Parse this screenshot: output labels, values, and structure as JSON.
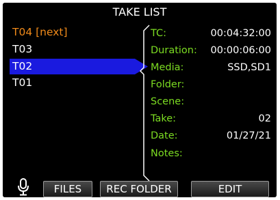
{
  "title": "TAKE LIST",
  "takes": [
    {
      "label": "T04 [next]",
      "state": "next"
    },
    {
      "label": "T03",
      "state": "normal"
    },
    {
      "label": "T02",
      "state": "selected"
    },
    {
      "label": "T01",
      "state": "normal"
    }
  ],
  "details": [
    {
      "label": "TC:",
      "value": "00:04:32:00"
    },
    {
      "label": "Duration:",
      "value": "00:00:06:00"
    },
    {
      "label": "Media:",
      "value": "SSD,SD1"
    },
    {
      "label": "Folder:",
      "value": ""
    },
    {
      "label": "Scene:",
      "value": ""
    },
    {
      "label": "Take:",
      "value": "02"
    },
    {
      "label": "Date:",
      "value": "01/27/21"
    },
    {
      "label": "Notes:",
      "value": ""
    }
  ],
  "toolbar": {
    "mic_icon": "microphone-icon",
    "files_label": "FILES",
    "rec_folder_label": "REC FOLDER",
    "edit_label": "EDIT"
  },
  "colors": {
    "next_take": "#f08a1a",
    "selected_bg": "#1a1adf",
    "detail_label": "#7cdc22",
    "text": "#ffffff",
    "background": "#000000"
  }
}
